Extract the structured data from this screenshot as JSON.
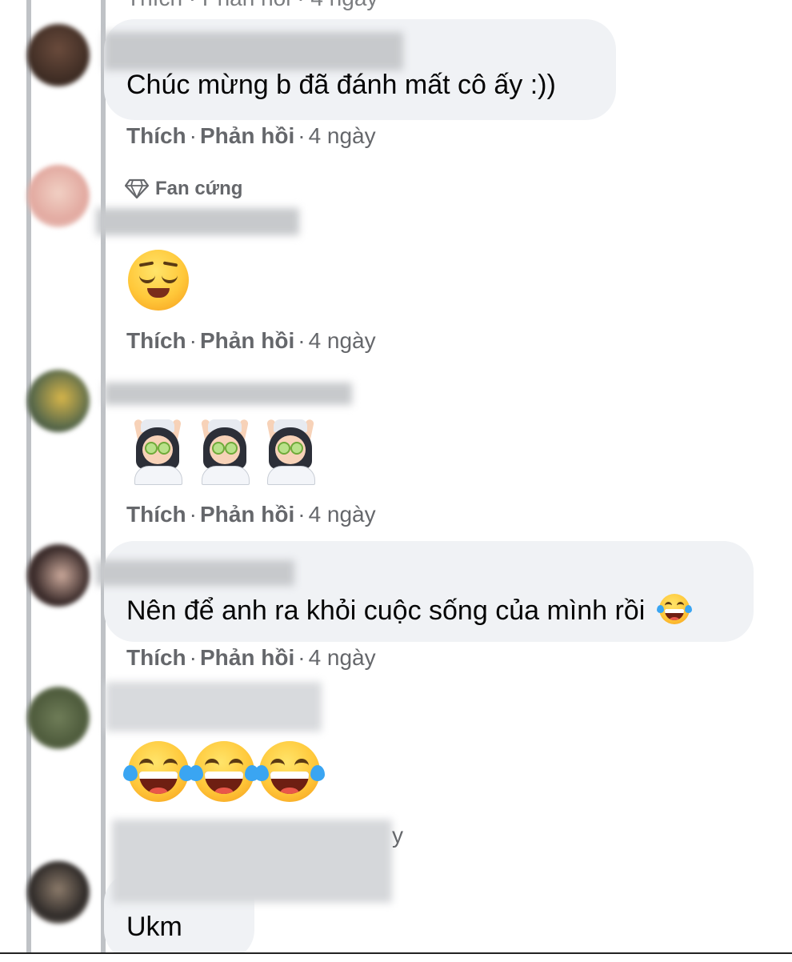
{
  "actions": {
    "like": "Thích",
    "reply": "Phản hồi",
    "separator": "·",
    "time": "4 ngày"
  },
  "top_partial": {
    "text": "Thích · Phản hồi · 4 ngày"
  },
  "comments": [
    {
      "text": "Chúc mừng b đã đánh mất cô ấy :))"
    },
    {
      "badge": "Fan cứng",
      "emoji": "relieved-face"
    },
    {
      "emoji": "person-in-steamy-room"
    },
    {
      "text": "Nên để anh ra khỏi cuộc sống của mình rồi",
      "emoji": "face-with-tears-of-joy"
    },
    {
      "emoji": "face-with-tears-of-joy"
    },
    {
      "text": "Ukm",
      "partial_meta": "y"
    }
  ],
  "colors": {
    "bubble": "#f0f2f5",
    "meta_text": "#65676b",
    "thread_line": "#bfc2c6"
  }
}
